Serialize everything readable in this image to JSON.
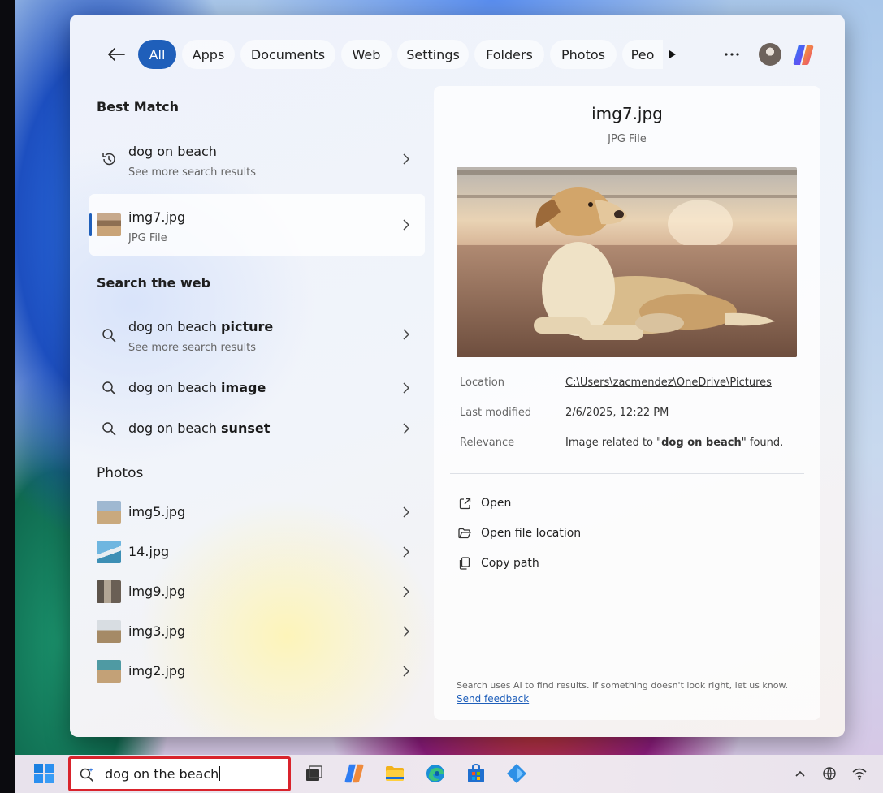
{
  "filters": {
    "items": [
      "All",
      "Apps",
      "Documents",
      "Web",
      "Settings",
      "Folders",
      "Photos",
      "Peo"
    ],
    "active": "All"
  },
  "best_match": {
    "title": "Best Match",
    "items": [
      {
        "primary": "dog on beach",
        "secondary": "See more search results",
        "icon": "history-icon"
      },
      {
        "primary": "img7.jpg",
        "secondary": "JPG File",
        "icon": "jpg-thumbnail"
      }
    ]
  },
  "search_web": {
    "title": "Search the web",
    "items": [
      {
        "prefix": "dog on beach ",
        "bold": "picture",
        "secondary": "See more search results"
      },
      {
        "prefix": "dog on beach ",
        "bold": "image"
      },
      {
        "prefix": "dog on beach ",
        "bold": "sunset"
      }
    ]
  },
  "photos": {
    "title": "Photos",
    "items": [
      "img5.jpg",
      "14.jpg",
      "img9.jpg",
      "img3.jpg",
      "img2.jpg"
    ]
  },
  "preview": {
    "filename": "img7.jpg",
    "filetype": "JPG File",
    "location_label": "Location",
    "location_value": "C:\\Users\\zacmendez\\OneDrive\\Pictures",
    "modified_label": "Last modified",
    "modified_value": "2/6/2025, 12:22 PM",
    "relevance_label": "Relevance",
    "relevance_prefix": "Image related to \"",
    "relevance_bold": "dog on beach",
    "relevance_suffix": "\" found.",
    "actions": [
      "Open",
      "Open file location",
      "Copy path"
    ],
    "footer_text": "Search uses AI to find results. If something doesn't look right, let us know.",
    "footer_link": "Send feedback"
  },
  "taskbar": {
    "search_value": "dog on the beach"
  },
  "colors": {
    "accent": "#1f5fba",
    "highlight_box": "#d9232c"
  }
}
